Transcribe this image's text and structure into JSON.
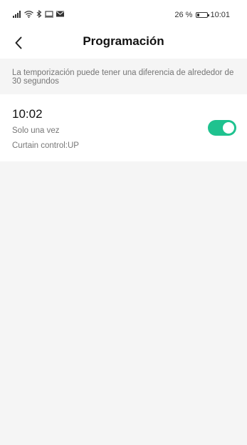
{
  "status_bar": {
    "battery_text": "26 %",
    "battery_level": 0.26,
    "time": "10:01",
    "icons": [
      "signal-icon",
      "wifi-icon",
      "bluetooth-icon",
      "screen-icon",
      "mail-icon"
    ]
  },
  "header": {
    "title": "Programación",
    "back_icon": "chevron-left-icon"
  },
  "info": {
    "text": "La temporización puede tener una diferencia de alrededor de 30 segundos"
  },
  "timer": {
    "time": "10:02",
    "repeat": "Solo una vez",
    "action": "Curtain control:UP",
    "enabled": true
  },
  "colors": {
    "accent": "#1fc28f",
    "background": "#f5f5f5"
  }
}
